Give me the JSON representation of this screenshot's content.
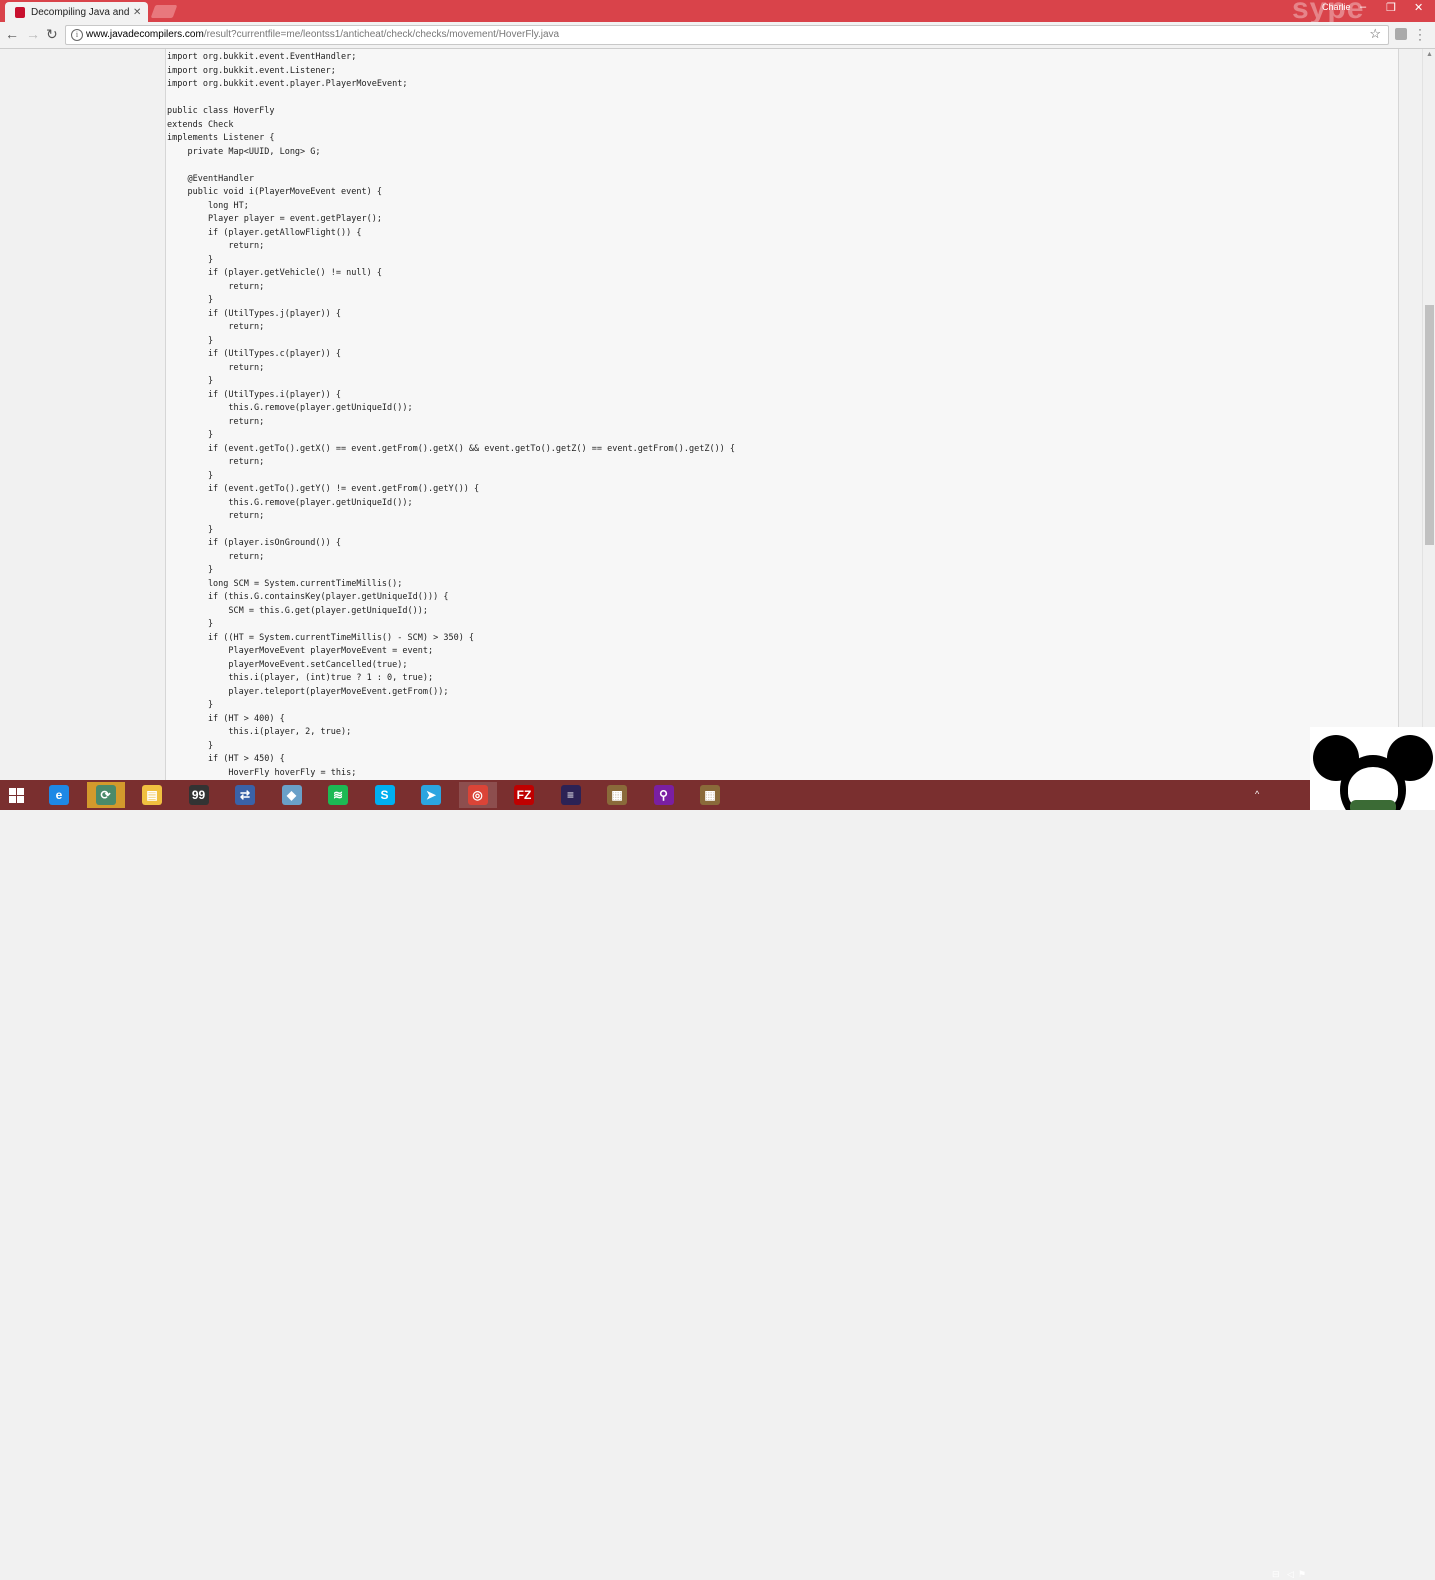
{
  "browser": {
    "tab_title": "Decompiling Java and A",
    "tab_close": "✕",
    "profile_name": "Charlie",
    "watermark": "sype",
    "window_buttons": [
      "–",
      "❐",
      "✕"
    ],
    "url_host": "www.javadecompilers.com",
    "url_path": "/result?currentfile=me/leontss1/anticheat/check/checks/movement/HoverFly.java",
    "back_icon": "arrow-left-icon",
    "forward_icon": "arrow-right-icon",
    "reload_icon": "reload-icon"
  },
  "code_lines": [
    "import org.bukkit.event.EventHandler;",
    "import org.bukkit.event.Listener;",
    "import org.bukkit.event.player.PlayerMoveEvent;",
    "",
    "public class HoverFly",
    "extends Check",
    "implements Listener {",
    "    private Map<UUID, Long> G;",
    "",
    "    @EventHandler",
    "    public void i(PlayerMoveEvent event) {",
    "        long HT;",
    "        Player player = event.getPlayer();",
    "        if (player.getAllowFlight()) {",
    "            return;",
    "        }",
    "        if (player.getVehicle() != null) {",
    "            return;",
    "        }",
    "        if (UtilTypes.j(player)) {",
    "            return;",
    "        }",
    "        if (UtilTypes.c(player)) {",
    "            return;",
    "        }",
    "        if (UtilTypes.i(player)) {",
    "            this.G.remove(player.getUniqueId());",
    "            return;",
    "        }",
    "        if (event.getTo().getX() == event.getFrom().getX() && event.getTo().getZ() == event.getFrom().getZ()) {",
    "            return;",
    "        }",
    "        if (event.getTo().getY() != event.getFrom().getY()) {",
    "            this.G.remove(player.getUniqueId());",
    "            return;",
    "        }",
    "        if (player.isOnGround()) {",
    "            return;",
    "        }",
    "        long SCM = System.currentTimeMillis();",
    "        if (this.G.containsKey(player.getUniqueId())) {",
    "            SCM = this.G.get(player.getUniqueId());",
    "        }",
    "        if ((HT = System.currentTimeMillis() - SCM) > 350) {",
    "            PlayerMoveEvent playerMoveEvent = event;",
    "            playerMoveEvent.setCancelled(true);",
    "            this.i(player, (int)true ? 1 : 0, true);",
    "            player.teleport(playerMoveEvent.getFrom());",
    "        }",
    "        if (HT > 400) {",
    "            this.i(player, 2, true);",
    "        }",
    "        if (HT > 450) {",
    "            HoverFly hoverFly = this;"
  ],
  "taskbar": {
    "apps": [
      {
        "name": "internet-explorer",
        "glyph": "e",
        "color": "#1e88e5"
      },
      {
        "name": "app-2",
        "glyph": "⟳",
        "color": "#4a8a6a",
        "highlight": true
      },
      {
        "name": "file-explorer",
        "glyph": "▤",
        "color": "#f0c040"
      },
      {
        "name": "app-4",
        "glyph": "99",
        "color": "#333333"
      },
      {
        "name": "network-app",
        "glyph": "⇄",
        "color": "#3a62a8"
      },
      {
        "name": "app-6",
        "glyph": "◆",
        "color": "#6aa0c8"
      },
      {
        "name": "spotify",
        "glyph": "≋",
        "color": "#1db954"
      },
      {
        "name": "skype",
        "glyph": "S",
        "color": "#00aff0"
      },
      {
        "name": "telegram",
        "glyph": "➤",
        "color": "#2ca5e0"
      },
      {
        "name": "chrome",
        "glyph": "◎",
        "color": "#db4437",
        "active": true
      },
      {
        "name": "filezilla",
        "glyph": "FZ",
        "color": "#bf0000"
      },
      {
        "name": "eclipse",
        "glyph": "≡",
        "color": "#2c2255"
      },
      {
        "name": "minecraft-1",
        "glyph": "▦",
        "color": "#8a6a3a"
      },
      {
        "name": "search-app",
        "glyph": "⚲",
        "color": "#7a1fa2"
      },
      {
        "name": "minecraft-2",
        "glyph": "▦",
        "color": "#8a6a3a"
      }
    ],
    "tray_text": "^"
  }
}
